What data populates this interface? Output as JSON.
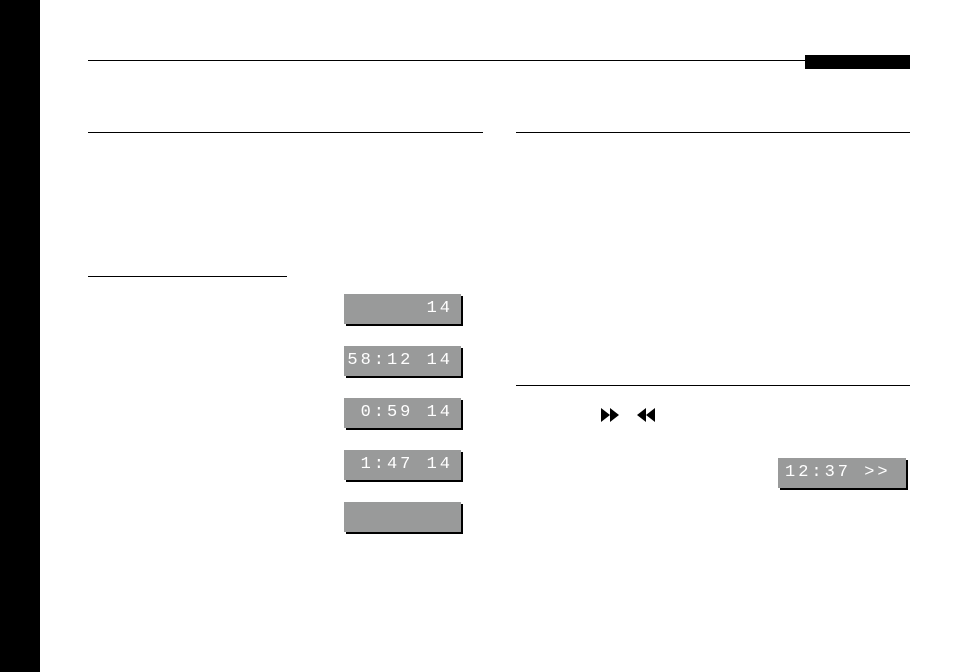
{
  "displays": {
    "d1": "14",
    "d2": "58:12 14",
    "d3": " 0:59 14",
    "d4": " 1:47 14",
    "d5": "",
    "right": "12:37 >>"
  }
}
